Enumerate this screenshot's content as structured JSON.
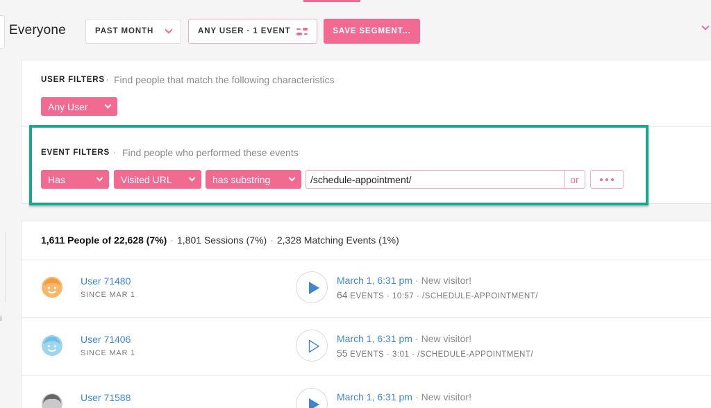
{
  "header": {
    "segment_title": "Everyone",
    "time_range_label": "PAST MONTH",
    "filter_summary_label": "ANY USER · 1 EVENT",
    "save_segment_label": "SAVE SEGMENT..."
  },
  "user_filters": {
    "label": "USER FILTERS",
    "separator": "·",
    "description": "Find people that match the following characteristics",
    "select_value": "Any User"
  },
  "event_filters": {
    "label": "EVENT FILTERS",
    "separator": "·",
    "description": "Find people who performed these events",
    "has_select": "Has",
    "event_select": "Visited URL",
    "operator_select": "has substring",
    "url_value": "/schedule-appointment/",
    "or_label": "or"
  },
  "summary": {
    "people": "1,611 People of 22,628 (7%)",
    "sessions": "1,801 Sessions (7%)",
    "events": "2,328 Matching Events (1%)",
    "separator": "·"
  },
  "rows": [
    {
      "name": "User 71480",
      "since": "SINCE MAR 1",
      "date": "March 1, 6:31 pm",
      "note": "New visitor!",
      "events_count": "64",
      "events_label": "EVENTS",
      "duration": "10:57",
      "page": "/SCHEDULE-APPOINTMENT/",
      "avatar": "orange-face-icon",
      "play": "filled"
    },
    {
      "name": "User 71406",
      "since": "SINCE MAR 1",
      "date": "March 1, 6:31 pm",
      "note": "New visitor!",
      "events_count": "55",
      "events_label": "EVENTS",
      "duration": "3:01",
      "page": "/SCHEDULE-APPOINTMENT/",
      "avatar": "blue-face-icon",
      "play": "outline"
    },
    {
      "name": "User 71588",
      "since": "",
      "date": "March 1, 6:31 pm",
      "note": "New visitor!",
      "avatar": "gray-face-icon",
      "play": "filled"
    }
  ],
  "colors": {
    "accent_pink": "#f06a92",
    "link_blue": "#3d86d6",
    "highlight_teal": "#16a890"
  }
}
